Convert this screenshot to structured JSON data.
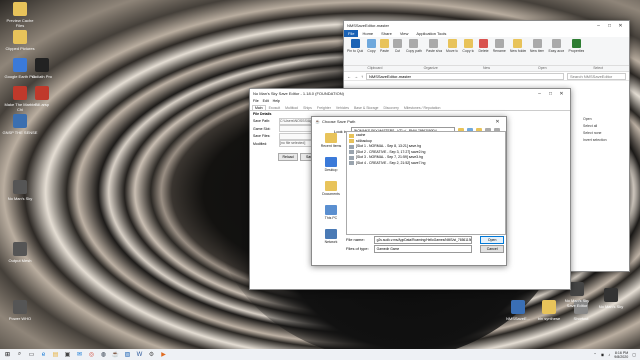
{
  "desktop_icons_left": [
    {
      "label": "Preview Cache Files",
      "color": "#e8c35a"
    },
    {
      "label": "Clipped Pictures",
      "color": "#e8c35a"
    },
    {
      "label": "Google Earth Pro",
      "color": "#3b7ad9"
    },
    {
      "label": "Goliath Pro",
      "color": "#222222"
    },
    {
      "label": "Make The Marble Chi",
      "color": "#c0392b"
    },
    {
      "label": "Bill.arsp",
      "color": "#c0392b"
    },
    {
      "label": "GNSP THE SENSE",
      "color": "#3b6fb0"
    },
    {
      "label": "No Man's Sky",
      "color": "#555555"
    },
    {
      "label": "Output Mesh",
      "color": "#555555"
    },
    {
      "label": "Power WHO",
      "color": "#555555"
    }
  ],
  "desktop_icons_bottom": [
    {
      "label": "NMSSaveE...",
      "color": "#3a6fb5"
    },
    {
      "label": "bin synthese",
      "color": "#e8c35a"
    },
    {
      "label": "Shortcut",
      "color": "#888888"
    },
    {
      "label": "No Man's Sky Save Editor",
      "color": "#444444"
    },
    {
      "label": "No Man's Sky",
      "color": "#333333"
    }
  ],
  "explorer": {
    "title": "NMSSaveEditor-master",
    "tabs": [
      "File",
      "Home",
      "Share",
      "View",
      "Application Tools"
    ],
    "ribbon_buttons": [
      "Pin to Quick access",
      "Copy",
      "Paste",
      "Cut",
      "Copy path",
      "Paste shortcut",
      "Move to",
      "Copy to",
      "Delete",
      "Rename",
      "New folder",
      "New item",
      "Easy access",
      "Properties",
      "Open",
      "Edit",
      "History",
      "Select all",
      "Select none",
      "Invert selection"
    ],
    "groups": [
      "Clipboard",
      "Organize",
      "New",
      "Open",
      "Select"
    ],
    "address": "NMSSaveEditor-master",
    "search_placeholder": "Search NMSSaveEditor",
    "side_items": [
      "Open",
      "Select all",
      "Select none",
      "Invert selection"
    ]
  },
  "editor": {
    "title": "No Man's Sky Save Editor - 1.18.0 (FOUNDATION)",
    "menu": [
      "File",
      "Edit",
      "Help"
    ],
    "tabs": [
      "Main",
      "Exosuit",
      "Multitool",
      "Ships",
      "Freighter",
      "Vehicles",
      "Base & Storage",
      "Discovery",
      "Milestones / Reputation"
    ],
    "section_title": "File Details",
    "fields": [
      {
        "label": "Save Path:",
        "value": "C:\\Users\\NOSSS\\AppData\\..."
      },
      {
        "label": "Game Slot:",
        "value": ""
      },
      {
        "label": "Save Files:",
        "value": ""
      },
      {
        "label": "Modified:",
        "value": "[no file selected]"
      }
    ],
    "buttons": [
      "Reload",
      "Save"
    ]
  },
  "dialog": {
    "title": "Choose Save Path",
    "look_in_label": "Look in:",
    "look_in_value": "[NOMAN'S SKY MASTERS - VT] ~/...PMAL76862090D4",
    "places": [
      "Recent Items",
      "Desktop",
      "Documents",
      "This PC",
      "Network"
    ],
    "files": [
      {
        "name": "cache",
        "type": "folder"
      },
      {
        "name": "st4backup",
        "type": "folder"
      },
      {
        "name": "[Slot 1 - NORMAL - Sep 8, 13:21] save.hg",
        "type": "file"
      },
      {
        "name": "[Slot 2 - CREATIVE - Sep 3, 17:27] save2.hg",
        "type": "file"
      },
      {
        "name": "[Slot 3 - NORMAL - Sep 7, 21:59] save3.hg",
        "type": "file"
      },
      {
        "name": "[Slot 4 - CREATIVE - Sep 2, 21:52] save7.hg",
        "type": "file"
      }
    ],
    "filename_label": "File name:",
    "filename_value": "g2s.sudk.v.ms/AppData/Roaming/HelloGames/NMS/st_76561198030384705",
    "filetype_label": "Files of type:",
    "filetype_value": "Gamedir Game",
    "open_label": "Open",
    "cancel_label": "Cancel"
  },
  "taskbar": {
    "items": [
      "start",
      "search",
      "task-view",
      "edge",
      "explorer",
      "store",
      "mail",
      "chrome",
      "steam",
      "java",
      "photos",
      "word",
      "settings",
      "media"
    ],
    "time": "8:16 PM",
    "date": "9/8/2020"
  }
}
